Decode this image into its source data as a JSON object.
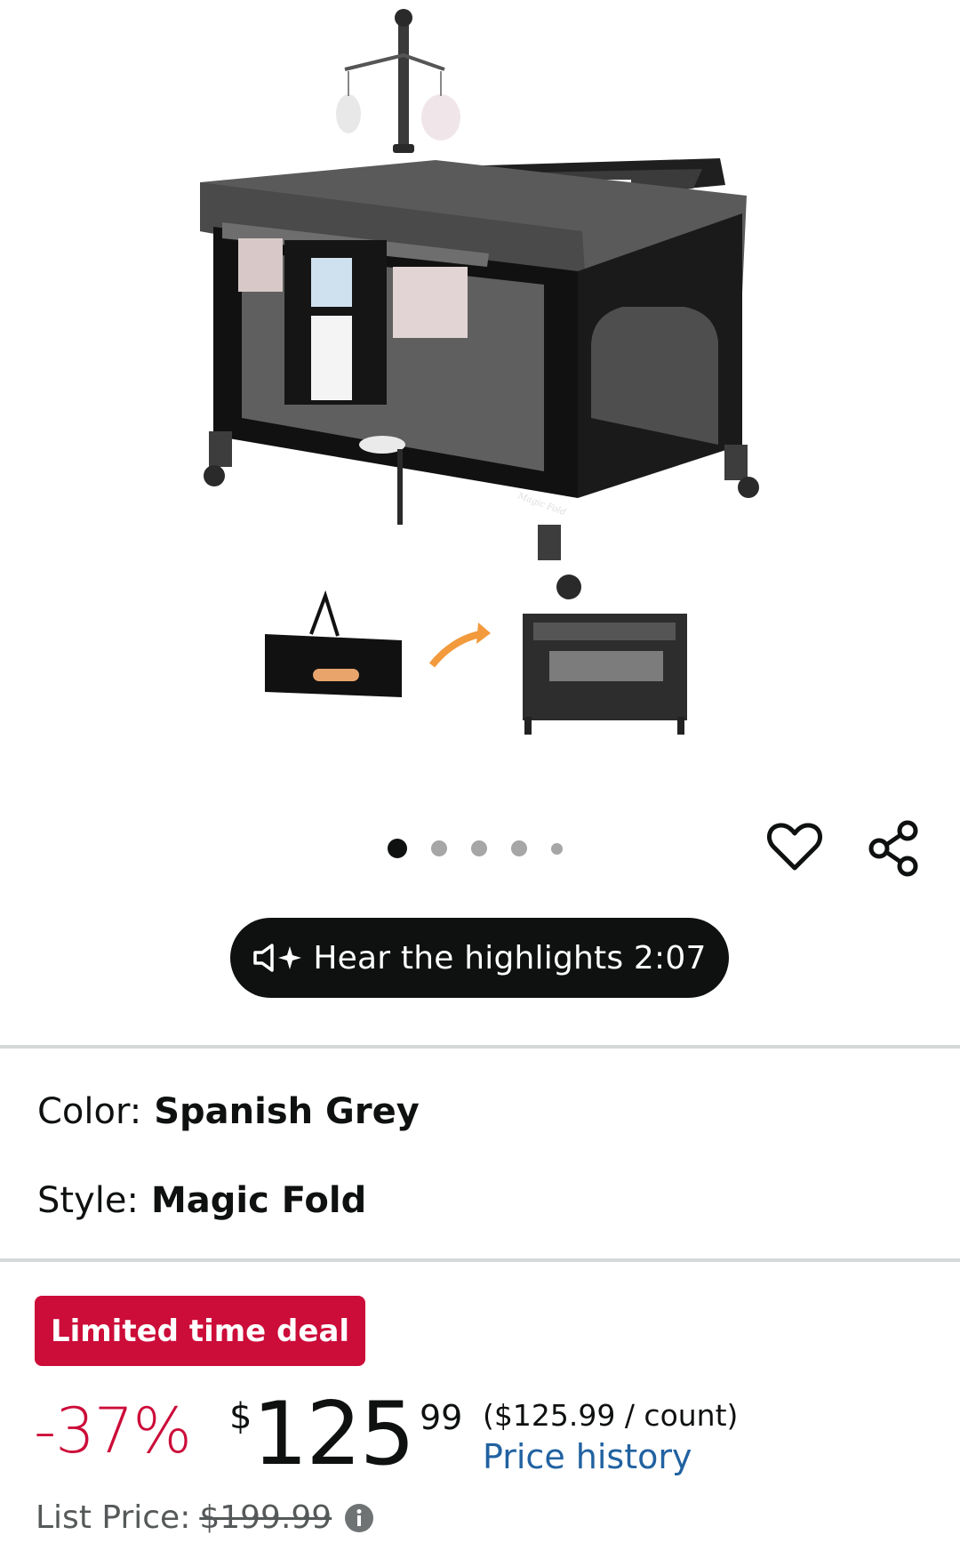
{
  "gallery": {
    "image_count": 5,
    "active_index": 0,
    "brand_logo_text": "Pomobaby",
    "feature_label": "Magic Fold"
  },
  "audio": {
    "label": "Hear the highlights 2:07"
  },
  "variations": {
    "color_label": "Color:",
    "color_value": "Spanish Grey",
    "style_label": "Style:",
    "style_value": "Magic Fold"
  },
  "pricing": {
    "deal_badge": "Limited time deal",
    "discount": "-37%",
    "currency_symbol": "$",
    "price_whole": "125",
    "price_fraction": "99",
    "unit_price": "($125.99 / count)",
    "price_history_link": "Price history",
    "list_price_label": "List Price:",
    "list_price_value": "$199.99"
  },
  "colors": {
    "deal_red": "#cc0c39",
    "link_blue": "#2162a1",
    "text": "#0f1111",
    "muted": "#565959"
  }
}
